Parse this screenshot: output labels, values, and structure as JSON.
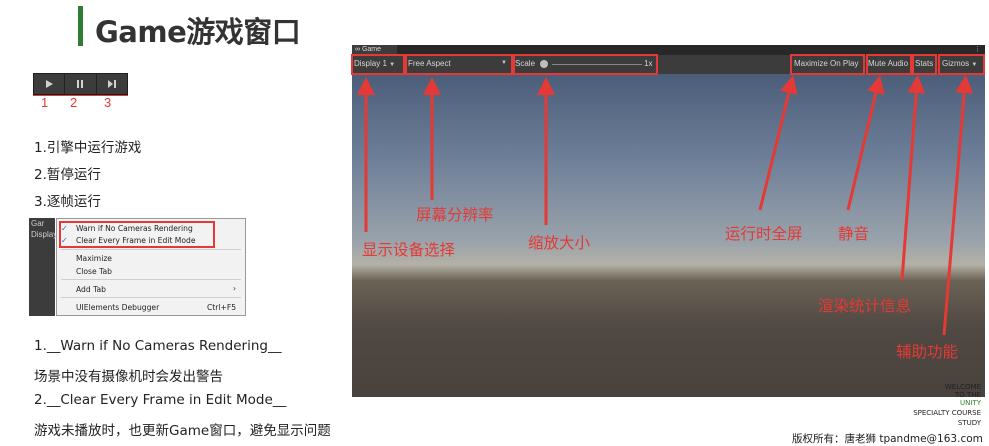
{
  "title": "Game游戏窗口",
  "control_numbers": [
    "1",
    "2",
    "3"
  ],
  "control_desc": [
    "1.引擎中运行游戏",
    "2.暂停运行",
    "3.逐帧运行"
  ],
  "menu": {
    "tab_title": "Gar",
    "tab_sub": "Display",
    "warn": "Warn if No Cameras Rendering",
    "clear": "Clear Every Frame in Edit Mode",
    "maximize": "Maximize",
    "close_tab": "Close Tab",
    "add_tab": "Add Tab",
    "add_tab_arrow": "›",
    "uielements": "UIElements Debugger",
    "shortcut": "Ctrl+F5"
  },
  "notes": [
    "1.__Warn if No Cameras Rendering__",
    "场景中没有摄像机时会发出警告",
    "2.__Clear Every Frame in Edit Mode__",
    "游戏未播放时，也更新Game窗口，避免显示问题"
  ],
  "game": {
    "tab": "Game",
    "display": "Display 1",
    "aspect": "Free Aspect",
    "scale_label": "Scale",
    "scale_value": "1x",
    "maximize": "Maximize On Play",
    "mute": "Mute Audio",
    "stats": "Stats",
    "gizmos": "Gizmos"
  },
  "annotations": {
    "resolution": "屏幕分辨率",
    "display_select": "显示设备选择",
    "zoom": "缩放大小",
    "fullscreen": "运行时全屏",
    "mute": "静音",
    "stats": "渲染统计信息",
    "gizmos": "辅助功能"
  },
  "watermark": [
    "WELCOME",
    "TO THE",
    "UNITY",
    "SPECIALTY COURSE",
    "STUDY"
  ],
  "copyright": "版权所有：唐老狮 tpandme@163.com"
}
